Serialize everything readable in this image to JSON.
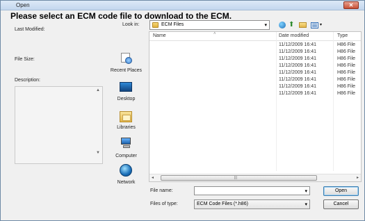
{
  "window": {
    "title": "Open",
    "close_glyph": "✕",
    "heading": "Please select an ECM code file to download to the ECM."
  },
  "meta": {
    "last_modified_label": "Last Modified:",
    "file_size_label": "File Size:",
    "description_label": "Description:"
  },
  "toolbar": {
    "look_in_label": "Look in:",
    "look_in_value": "ECM Files",
    "icons": [
      "back-icon",
      "up-folder-icon",
      "new-folder-icon",
      "views-icon"
    ]
  },
  "places": [
    {
      "label": "Recent Places",
      "icon": "recent-places-icon"
    },
    {
      "label": "Desktop",
      "icon": "desktop-icon"
    },
    {
      "label": "Libraries",
      "icon": "libraries-icon"
    },
    {
      "label": "Computer",
      "icon": "computer-icon"
    },
    {
      "label": "Network",
      "icon": "network-icon"
    }
  ],
  "filelist": {
    "columns": {
      "name": "Name",
      "date": "Date modified",
      "type": "Type"
    },
    "rows": [
      {
        "date": "11/12/2009 16:41",
        "type": "H86 File"
      },
      {
        "date": "11/12/2009 16:41",
        "type": "H86 File"
      },
      {
        "date": "11/12/2009 16:41",
        "type": "H86 File"
      },
      {
        "date": "11/12/2009 16:41",
        "type": "H86 File"
      },
      {
        "date": "11/12/2009 16:41",
        "type": "H86 File"
      },
      {
        "date": "11/12/2009 16:41",
        "type": "H86 File"
      },
      {
        "date": "11/12/2009 16:41",
        "type": "H86 File"
      },
      {
        "date": "11/12/2009 16:41",
        "type": "H86 File"
      }
    ]
  },
  "footer": {
    "file_name_label": "File name:",
    "file_name_value": "",
    "file_type_label": "Files of type:",
    "file_type_value": "ECM Code Files (*.h86)",
    "open_label": "Open",
    "cancel_label": "Cancel"
  }
}
